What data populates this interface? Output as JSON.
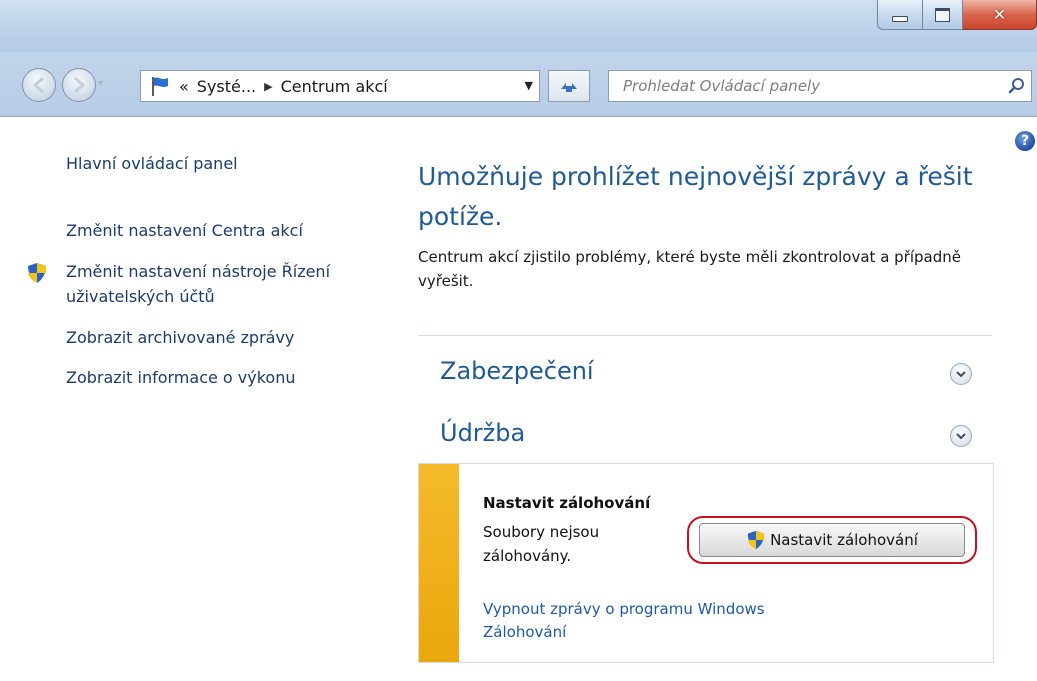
{
  "window": {
    "minimize_label": "minimize",
    "maximize_label": "maximize",
    "close_label": "close"
  },
  "address": {
    "prefix": "«",
    "crumb_1": "Systé...",
    "crumb_2": "Centrum akcí"
  },
  "search": {
    "placeholder": "Prohledat Ovládací panely"
  },
  "sidebar": {
    "home_link": "Hlavní ovládací panel",
    "links": [
      "Změnit nastavení Centra akcí",
      "Změnit nastavení nástroje Řízení uživatelských účtů",
      "Zobrazit archivované zprávy",
      "Zobrazit informace o výkonu"
    ]
  },
  "main": {
    "title": "Umožňuje prohlížet nejnovější zprávy a řešit potíže.",
    "description": "Centrum akcí zjistilo problémy, které byste měli zkontrolovat a případně vyřešit.",
    "sections": [
      {
        "label": "Zabezpečení"
      },
      {
        "label": "Údržba"
      }
    ],
    "backup": {
      "title": "Nastavit zálohování",
      "text": "Soubory nejsou zálohovány.",
      "button": "Nastavit zálohování",
      "link": "Vypnout zprávy o programu Windows Zálohování"
    }
  },
  "colors": {
    "link_blue": "#1e5a96",
    "warning_bar": "#f0b020",
    "highlight_ring": "#c8101e"
  },
  "icons": {
    "back": "back-arrow-icon",
    "forward": "forward-arrow-icon",
    "flag": "action-center-flag-icon",
    "refresh": "refresh-icon",
    "search": "search-icon",
    "help": "help-icon",
    "uac_shield": "uac-shield-icon",
    "expand": "chevron-down-icon"
  }
}
